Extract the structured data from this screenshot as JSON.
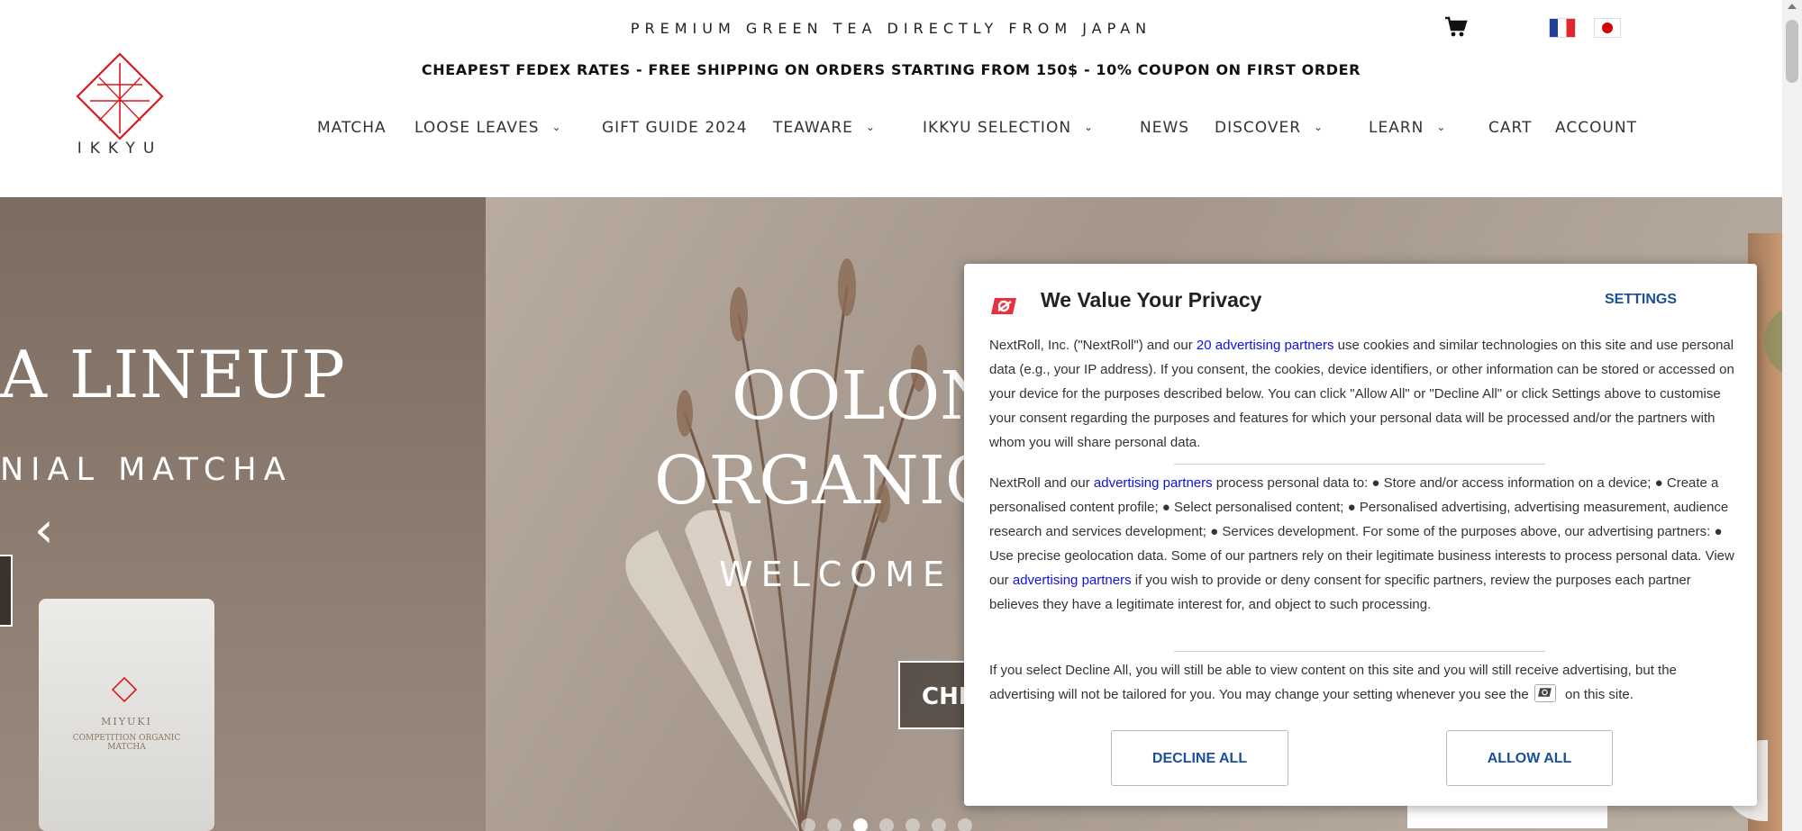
{
  "header": {
    "tagline": "PREMIUM GREEN TEA DIRECTLY FROM JAPAN",
    "promo": "CHEAPEST FEDEX RATES - FREE SHIPPING ON ORDERS STARTING FROM 150$ - 10% COUPON ON FIRST ORDER",
    "logo_text": "IKKYU",
    "icons": {
      "cart": "cart-icon",
      "flags": [
        "flag-france",
        "flag-japan"
      ]
    },
    "brand_color": "#d71920"
  },
  "nav": {
    "items": [
      {
        "label": "MATCHA",
        "has_dropdown": false
      },
      {
        "label": "LOOSE LEAVES",
        "has_dropdown": true
      },
      {
        "label": "GIFT GUIDE 2024",
        "has_dropdown": false
      },
      {
        "label": "TEAWARE",
        "has_dropdown": true
      },
      {
        "label": "IKKYU SELECTION",
        "has_dropdown": true
      },
      {
        "label": "NEWS",
        "has_dropdown": false
      },
      {
        "label": "DISCOVER",
        "has_dropdown": true
      },
      {
        "label": "LEARN",
        "has_dropdown": true
      },
      {
        "label": "CART",
        "has_dropdown": false
      },
      {
        "label": "ACCOUNT",
        "has_dropdown": false
      }
    ]
  },
  "hero": {
    "left_slide": {
      "title": "A LINEUP",
      "subtitle": "NIAL MATCHA"
    },
    "right_slide": {
      "title_line1": "OOLON",
      "title_line2": "ORGANIC",
      "subtitle": "WELCOME",
      "cta": "CHE"
    },
    "pouch": {
      "name": "MIYUKI",
      "desc": "COMPETITION ORGANIC MATCHA"
    },
    "prev_arrow": "‹",
    "slide_count": 7,
    "active_slide": 3
  },
  "privacy_modal": {
    "title": "We Value Your Privacy",
    "settings_label": "SETTINGS",
    "p1": {
      "before": "NextRoll, Inc. (\"NextRoll\") and our ",
      "link": "20 advertising partners",
      "after": " use cookies and similar technologies on this site and use personal data (e.g., your IP address). If you consent, the cookies, device identifiers, or other information can be stored or accessed on your device for the purposes described below. You can click \"Allow All\" or \"Decline All\" or click Settings above to customise your consent regarding the purposes and features for which your personal data will be processed and/or the partners with whom you will share personal data."
    },
    "p2": {
      "before": "NextRoll and our ",
      "link1": "advertising partners",
      "middle": " process personal data to: ● Store and/or access information on a device; ● Create a personalised content profile; ● Select personalised content; ● Personalised advertising, advertising measurement, audience research and services development; ● Services development. For some of the purposes above, our advertising partners: ● Use precise geolocation data. Some of our partners rely on their legitimate business interests to process personal data. View our ",
      "link2": "advertising partners",
      "after": " if you wish to provide or deny consent for specific partners, review the purposes each partner believes they have a legitimate interest for, and object to such processing."
    },
    "p3": {
      "before": "If you select Decline All, you will still be able to view content on this site and you will still receive advertising, but the advertising will not be tailored for you. You may change your setting whenever you see the",
      "after": "on this site."
    },
    "decline_label": "DECLINE ALL",
    "allow_label": "ALLOW ALL",
    "accent_color": "#1a4f9a",
    "logo_color": "#e8313e"
  }
}
